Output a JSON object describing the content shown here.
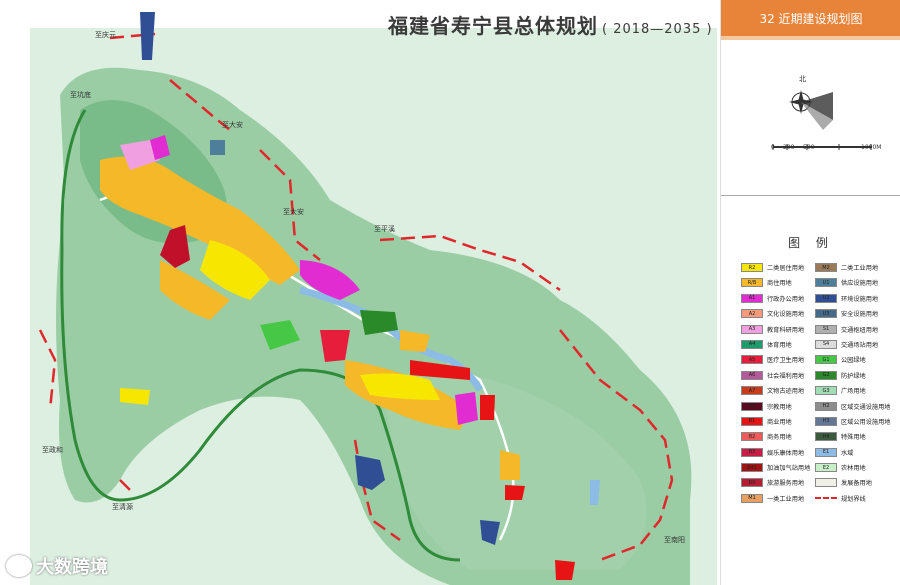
{
  "title": {
    "main": "福建省寿宁县总体规划",
    "years": "( 2018—2035 )"
  },
  "sheet": {
    "label": "32  近期建设规划图"
  },
  "compass": {
    "north": "北"
  },
  "scale": {
    "labels": [
      "0",
      "200",
      "500",
      "1000M"
    ]
  },
  "places": [
    {
      "id": "qingyuan",
      "text": "至庆元"
    },
    {
      "id": "kengdi",
      "text": "至坑底"
    },
    {
      "id": "daan1",
      "text": "至大安"
    },
    {
      "id": "daan2",
      "text": "至大安"
    },
    {
      "id": "pingxi",
      "text": "至平溪"
    },
    {
      "id": "zhenghe",
      "text": "至政和"
    },
    {
      "id": "qingyuan2",
      "text": "至清源"
    },
    {
      "id": "nanyang",
      "text": "至南阳"
    }
  ],
  "legend": {
    "title": "图  例",
    "items": [
      {
        "code": "R2",
        "name": "二类居住用地",
        "color": "#f7e600"
      },
      {
        "code": "M2",
        "name": "二类工业用地",
        "color": "#9b7a5a"
      },
      {
        "code": "R/B",
        "name": "商住用地",
        "color": "#f5b829"
      },
      {
        "code": "U1",
        "name": "供应设施用地",
        "color": "#4d7f9a"
      },
      {
        "code": "A1",
        "name": "行政办公用地",
        "color": "#e02cd1"
      },
      {
        "code": "U2",
        "name": "环境设施用地",
        "color": "#2f4e93"
      },
      {
        "code": "A2",
        "name": "文化设施用地",
        "color": "#f59a7a"
      },
      {
        "code": "U3",
        "name": "安全设施用地",
        "color": "#466a8a"
      },
      {
        "code": "A3",
        "name": "教育科研用地",
        "color": "#f0a0e0"
      },
      {
        "code": "S1",
        "name": "交通枢纽用地",
        "color": "#b0b0b0"
      },
      {
        "code": "A4",
        "name": "体育用地",
        "color": "#1e9b6a"
      },
      {
        "code": "S4",
        "name": "交通场站用地",
        "color": "#dcdcdc"
      },
      {
        "code": "A5",
        "name": "医疗卫生用地",
        "color": "#e61e3c"
      },
      {
        "code": "G1",
        "name": "公园绿地",
        "color": "#46c846"
      },
      {
        "code": "A6",
        "name": "社会福利用地",
        "color": "#b45a9b"
      },
      {
        "code": "G2",
        "name": "防护绿地",
        "color": "#2a8a2a"
      },
      {
        "code": "A7",
        "name": "文物古迹用地",
        "color": "#c83c1e"
      },
      {
        "code": "G3",
        "name": "广场用地",
        "color": "#a0dcb4"
      },
      {
        "code": "A9",
        "name": "宗教用地",
        "color": "#5a0a1e"
      },
      {
        "code": "H2",
        "name": "区域交通设施用地",
        "color": "#8c8c8c"
      },
      {
        "code": "B1",
        "name": "商业用地",
        "color": "#e61414"
      },
      {
        "code": "H3",
        "name": "区域公用设施用地",
        "color": "#647896"
      },
      {
        "code": "B2",
        "name": "商务用地",
        "color": "#f05a5a"
      },
      {
        "code": "H4",
        "name": "特殊用地",
        "color": "#3c5a3c"
      },
      {
        "code": "B3",
        "name": "娱乐康体用地",
        "color": "#c81e46"
      },
      {
        "code": "E1",
        "name": "水域",
        "color": "#8cbce6"
      },
      {
        "code": "B41",
        "name": "加油加气站用地",
        "color": "#a01414"
      },
      {
        "code": "E2",
        "name": "农林用地",
        "color": "#c8f0c8"
      },
      {
        "code": "B9",
        "name": "旅游服务用地",
        "color": "#b41e32"
      },
      {
        "code": "",
        "name": "发展备用地",
        "color": "#f0f0e6"
      },
      {
        "code": "M1",
        "name": "一类工业用地",
        "color": "#e6a064"
      },
      {
        "code": "",
        "name": "规划界线",
        "color": "#e0282c"
      }
    ]
  },
  "watermark": {
    "text": "大数跨境"
  }
}
